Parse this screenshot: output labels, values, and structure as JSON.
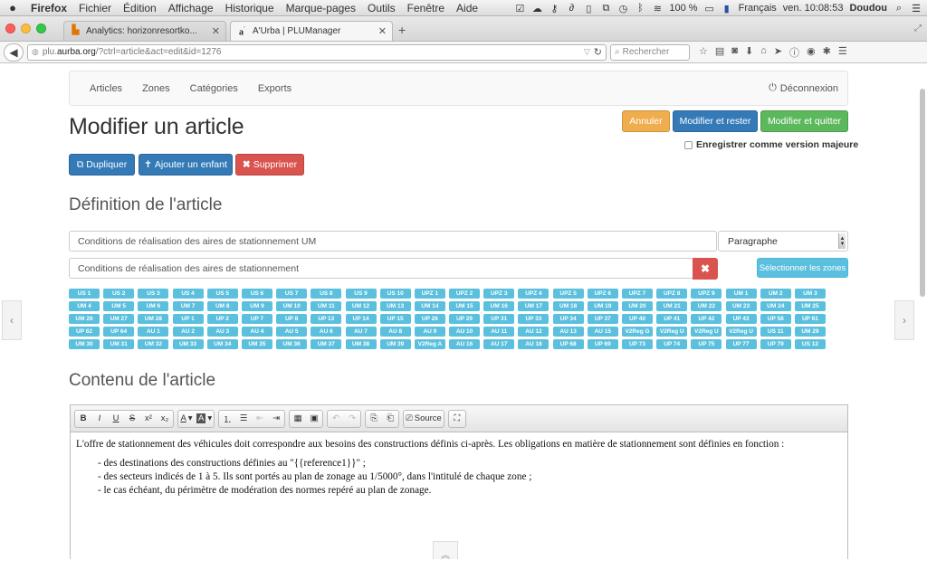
{
  "menubar": {
    "app": "Firefox",
    "items": [
      "Fichier",
      "Édition",
      "Affichage",
      "Historique",
      "Marque-pages",
      "Outils",
      "Fenêtre",
      "Aide"
    ],
    "battery": "100 %",
    "language": "Français",
    "clock": "ven. 10:08:53",
    "user": "Doudou"
  },
  "browser": {
    "tabs": [
      {
        "title": "Analytics: horizonresortko...",
        "active": false
      },
      {
        "title": "A'Urba | PLUManager",
        "active": true
      }
    ],
    "url_prefix": "plu.",
    "url_domain": "aurba.org",
    "url_path": "/?ctrl=article&act=edit&id=1276",
    "search_placeholder": "Rechercher"
  },
  "nav": {
    "items": [
      "Articles",
      "Zones",
      "Catégories",
      "Exports"
    ],
    "logout": "Déconnexion"
  },
  "page": {
    "title": "Modifier un article",
    "btn_cancel": "Annuler",
    "btn_save_stay": "Modifier et rester",
    "btn_save_quit": "Modifier et quitter",
    "major_version": "Enregistrer comme version majeure",
    "btn_duplicate": "Dupliquer",
    "btn_add_child": "Ajouter un enfant",
    "btn_delete": "Supprimer"
  },
  "definition": {
    "heading": "Définition de l'article",
    "title_value": "Conditions de réalisation des aires de stationnement UM",
    "type_value": "Paragraphe",
    "short_title_value": "Conditions de réalisation des aires de stationnement",
    "select_zones": "Sélectionner les zones",
    "zones": [
      "US 1",
      "US 2",
      "US 3",
      "US 4",
      "US 5",
      "US 6",
      "US 7",
      "US 8",
      "US 9",
      "US 10",
      "UPZ 1",
      "UPZ 2",
      "UPZ 3",
      "UPZ 4",
      "UPZ 5",
      "UPZ 6",
      "UPZ 7",
      "UPZ 8",
      "UPZ 9",
      "UM 1",
      "UM 2",
      "UM 3",
      "UM 4",
      "UM 5",
      "UM 6",
      "UM 7",
      "UM 8",
      "UM 9",
      "UM 10",
      "UM 11",
      "UM 12",
      "UM 13",
      "UM 14",
      "UM 15",
      "UM 16",
      "UM 17",
      "UM 18",
      "UM 19",
      "UM 20",
      "UM 21",
      "UM 22",
      "UM 23",
      "UM 24",
      "UM 25",
      "UM 26",
      "UM 27",
      "UM 28",
      "UP 1",
      "UP 2",
      "UP 7",
      "UP 8",
      "UP 13",
      "UP 14",
      "UP 15",
      "UP 26",
      "UP 29",
      "UP 31",
      "UP 33",
      "UP 34",
      "UP 37",
      "UP 40",
      "UP 41",
      "UP 42",
      "UP 43",
      "UP 58",
      "UP 61",
      "UP 62",
      "UP 64",
      "AU 1",
      "AU 2",
      "AU 3",
      "AU 4",
      "AU 5",
      "AU 6",
      "AU 7",
      "AU 8",
      "AU 9",
      "AU 10",
      "AU 11",
      "AU 12",
      "AU 13",
      "AU 15",
      "V2Reg G",
      "V2Reg U",
      "V2Reg U",
      "V2Reg U",
      "US 11",
      "UM 29",
      "UM 30",
      "UM 31",
      "UM 32",
      "UM 33",
      "UM 34",
      "UM 35",
      "UM 36",
      "UM 37",
      "UM 38",
      "UM 39",
      "V2Reg A",
      "AU 16",
      "AU 17",
      "AU 18",
      "UP 68",
      "UP 69",
      "UP 73",
      "UP 74",
      "UP 75",
      "UP 77",
      "UP 79",
      "US 12"
    ]
  },
  "contenu": {
    "heading": "Contenu de l'article",
    "source_label": "Source",
    "paragraph": "L'offre de stationnement des véhicules doit correspondre aux besoins des constructions définis ci-après. Les obligations en matière de stationnement sont définies en fonction :",
    "bullets": [
      "- des destinations des constructions définies au \"{{reference1}}\" ;",
      "- des secteurs indicés de 1 à 5. Ils sont portés au plan de zonage au 1/5000°, dans l'intitulé de chaque zone ;",
      "- le cas échéant, du périmètre de modération des normes repéré au plan de zonage."
    ]
  },
  "colors": {
    "primary": "#337ab7",
    "success": "#5cb85c",
    "warning": "#f0ad4e",
    "danger": "#d9534f",
    "info": "#5bc0de"
  }
}
